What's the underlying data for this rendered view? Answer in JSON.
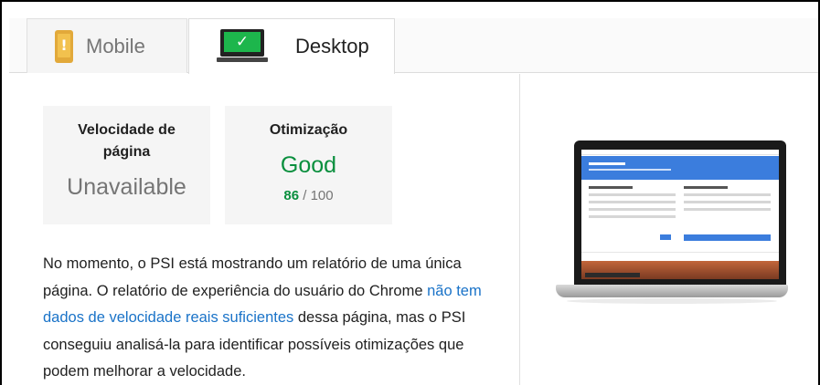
{
  "tabs": [
    {
      "label": "Mobile",
      "icon": "mobile-phone-icon",
      "active": false
    },
    {
      "label": "Desktop",
      "icon": "desktop-computer-icon",
      "active": true
    }
  ],
  "cards": {
    "speed": {
      "title": "Velocidade de página",
      "value": "Unavailable"
    },
    "optimization": {
      "title": "Otimização",
      "value": "Good",
      "score": "86",
      "max": "/ 100"
    }
  },
  "description": {
    "part1": "No momento, o PSI está mostrando um relatório de uma única página. O relatório de experiência do usuário do Chrome ",
    "link": "não tem dados de velocidade reais suficientes",
    "part2": " dessa página, mas o PSI conseguiu analisá-la para identificar possíveis otimizações que podem melhorar a velocidade."
  },
  "colors": {
    "good": "#0a8f3e",
    "link": "#1a73c8",
    "card_bg": "#f5f5f5"
  }
}
